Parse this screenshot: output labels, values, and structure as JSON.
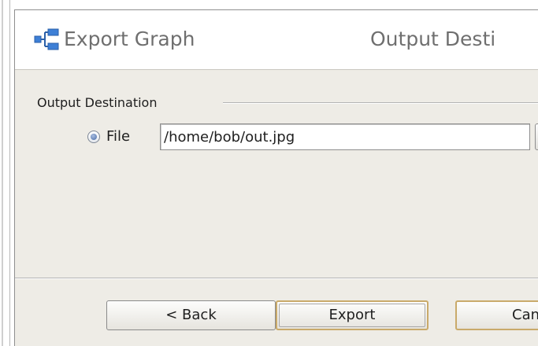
{
  "header": {
    "title": "Export Graph",
    "step_title": "Output Desti",
    "icon": "graph-hierarchy-icon",
    "icon_color": "#3d7fd6"
  },
  "output": {
    "group_title": "Output Destination",
    "file_option_label": "File",
    "file_selected": true,
    "path_value": "/home/bob/out.jpg"
  },
  "buttons": {
    "back_label": "< Back",
    "export_label": "Export",
    "cancel_label": "Can"
  },
  "colors": {
    "dialog_bg": "#eeece6",
    "header_text": "#6f6f6f",
    "default_button_border": "#c9aa6a"
  }
}
